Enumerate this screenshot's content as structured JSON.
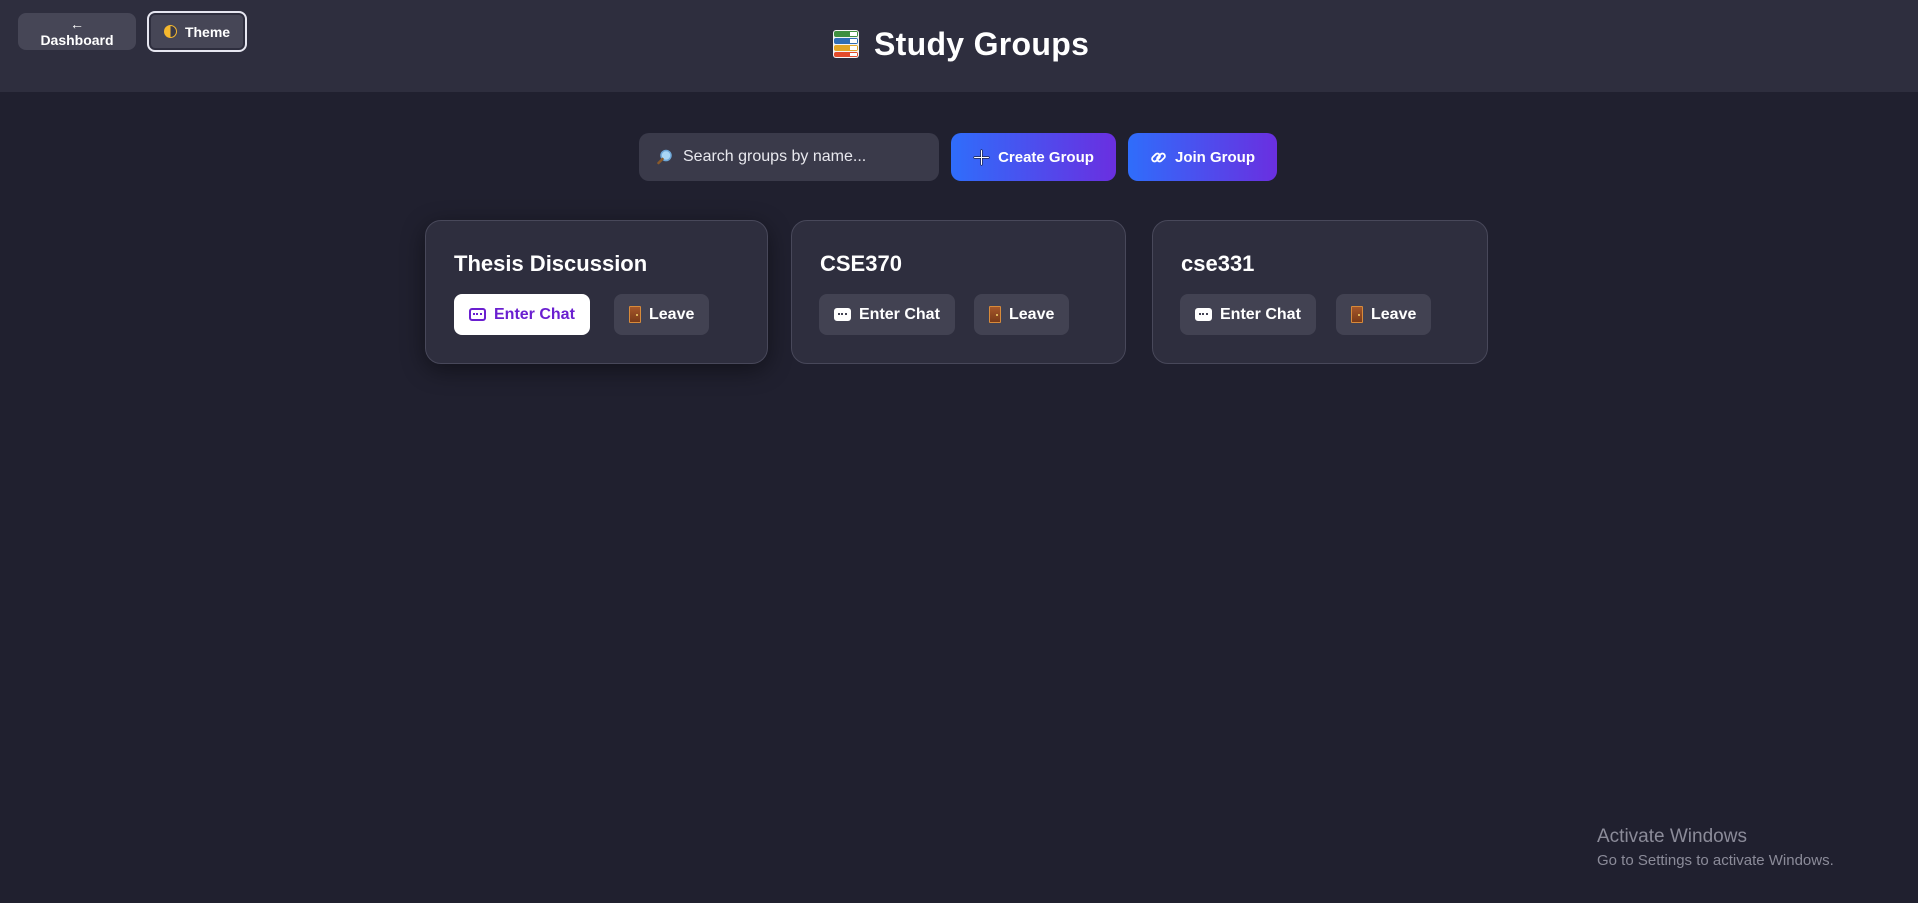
{
  "topbar": {
    "dashboard_label": "← Dashboard",
    "theme_label": "Theme",
    "title": "Study Groups"
  },
  "toolbar": {
    "search_placeholder": "Search groups by name...",
    "create_label": "Create Group",
    "join_label": "Join Group"
  },
  "groups": [
    {
      "name": "Thesis Discussion",
      "enter_label": "Enter Chat",
      "leave_label": "Leave"
    },
    {
      "name": "CSE370",
      "enter_label": "Enter Chat",
      "leave_label": "Leave"
    },
    {
      "name": "cse331",
      "enter_label": "Enter Chat",
      "leave_label": "Leave"
    }
  ],
  "watermark": {
    "title": "Activate Windows",
    "subtitle": "Go to Settings to activate Windows."
  },
  "colors": {
    "background": "#20202f",
    "topbar": "#2e2e3e",
    "accent_start": "#2f6dfb",
    "accent_end": "#6a2fe0",
    "active_text": "#6a1fd0"
  },
  "icons": [
    "books-icon",
    "search-icon",
    "plus-icon",
    "link-icon",
    "chat-icon",
    "door-icon",
    "half-moon-icon"
  ]
}
